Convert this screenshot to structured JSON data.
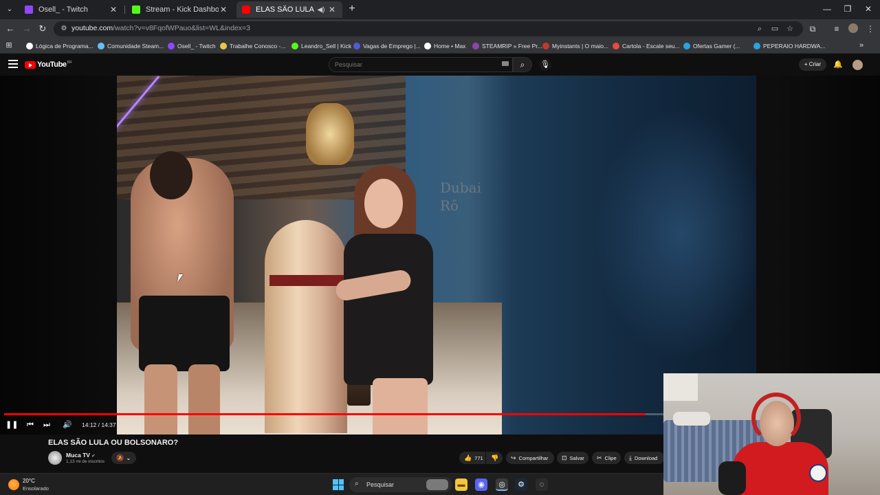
{
  "browser": {
    "tabs": [
      {
        "label": "Osell_ - Twitch",
        "color": "#9146ff",
        "active": false
      },
      {
        "label": "Stream - Kick Dashboard",
        "color": "#53fc18",
        "active": false
      },
      {
        "label": "ELAS SÃO LULA OU BOLSON",
        "color": "#ff0000",
        "active": true
      }
    ],
    "url_main": "youtube.com",
    "url_rest": "/watch?v=v8FqofWPauo&list=WL&index=3",
    "bookmarks": [
      {
        "label": "Lógica de Programa...",
        "color": "#ffffff"
      },
      {
        "label": "Comunidade Steam...",
        "color": "#66c0f4"
      },
      {
        "label": "Osell_ - Twitch",
        "color": "#9146ff"
      },
      {
        "label": "Trabalhe Conosco -...",
        "color": "#e8c547"
      },
      {
        "label": "Leandro_Sell | Kick",
        "color": "#53fc18"
      },
      {
        "label": "Vagas de Emprego |...",
        "color": "#4f5bd5"
      },
      {
        "label": "Home • Max",
        "color": "#ffffff"
      },
      {
        "label": "STEAMRIP » Free Pr...",
        "color": "#8e44ad"
      },
      {
        "label": "Myinstants | O maio...",
        "color": "#c0392b"
      },
      {
        "label": "Cartola - Escale seu...",
        "color": "#e74c3c"
      },
      {
        "label": "Ofertas Gamer (...",
        "color": "#2aa3e0"
      },
      {
        "label": "PEPERAIO HARDWA...",
        "color": "#2aa3e0"
      }
    ]
  },
  "youtube": {
    "logo": "YouTube",
    "region": "BR",
    "search_placeholder": "Pesquisar",
    "create_label": "Criar"
  },
  "player": {
    "time": "14:12 / 14:37",
    "progress": 0.9715,
    "video_text": "Dubai\nRô"
  },
  "video": {
    "title": "ELAS SÃO LULA OU BOLSONARO?",
    "channel": "Muca TV",
    "subscribers": "1,13 mi de inscritos",
    "likes": "771",
    "actions": {
      "share": "Compartilhar",
      "save": "Salvar",
      "clip": "Clipe",
      "download": "Download"
    }
  },
  "taskbar": {
    "temperature": "20°C",
    "condition": "Ensolarado",
    "search": "Pesquisar"
  }
}
